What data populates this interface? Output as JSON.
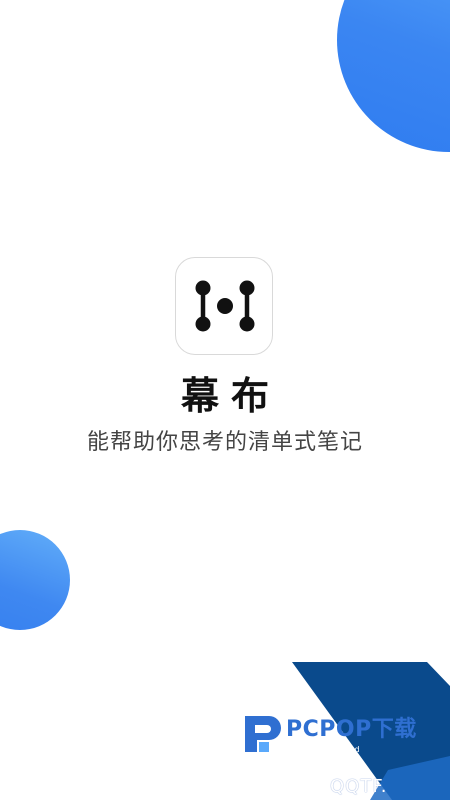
{
  "app": {
    "name": "幕布",
    "tagline": "能帮助你思考的清单式笔记",
    "icon": "mubu-logo-icon"
  },
  "watermark": {
    "title": "PCPOP下载",
    "subtitle": "PCPOP Download",
    "corner_text": "QQTF.",
    "icon": "pcpop-logo-icon"
  },
  "colors": {
    "accent_blue": "#3b86f2",
    "watermark_dark_blue": "#0a4a8c",
    "watermark_light_blue": "#2f6fd1"
  }
}
